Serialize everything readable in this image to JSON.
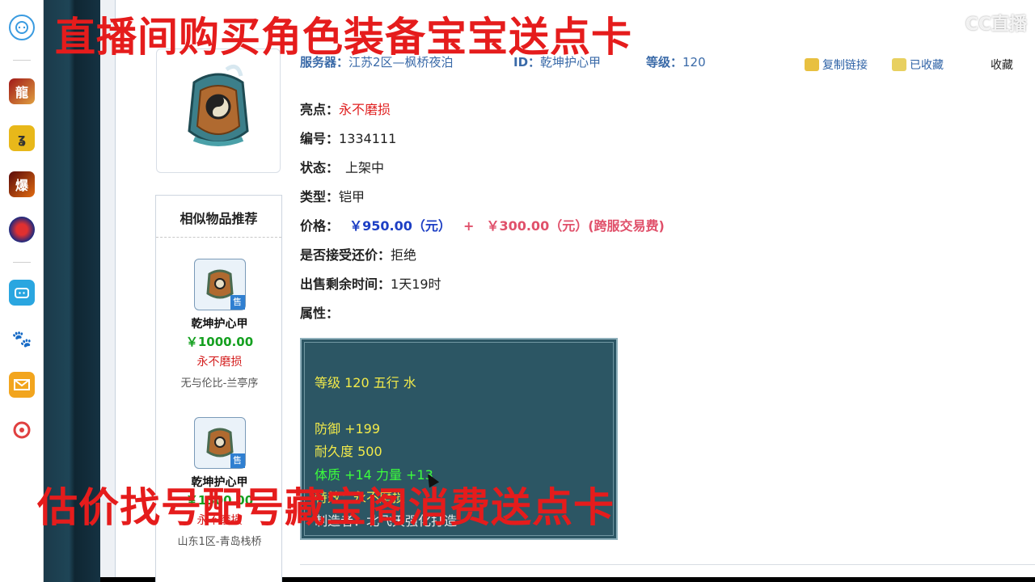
{
  "overlay": {
    "top_text": "直播间购买角色装备宝宝送点卡",
    "bottom_text": "估价找号配号藏宝阁消费送点卡",
    "watermark": "CC直播"
  },
  "dock": {
    "icons": [
      "chat-icon",
      "game-dragon-icon",
      "game-swirl-icon",
      "game-bao-icon",
      "game-ball-icon",
      "bilibili-icon",
      "baidu-icon",
      "mail-icon",
      "netease-icon"
    ]
  },
  "item": {
    "server_label": "服务器：",
    "server_value": "江苏2区—枫桥夜泊",
    "id_label": "ID：",
    "id_value": "乾坤护心甲",
    "level_label": "等级：",
    "level_value": "120",
    "copy_link": "复制链接",
    "share_label": "已收藏",
    "favorite_label": "收藏",
    "highlight_label": "亮点：",
    "highlight_value": "永不磨损",
    "number_label": "编号：",
    "number_value": "1334111",
    "status_label": "状态：",
    "status_value": "上架中",
    "type_label": "类型：",
    "type_value": "铠甲",
    "price_label": "价格：",
    "price_value": "￥950.00（元）",
    "price_plus": "+",
    "fee_value": "￥300.00（元）(跨服交易费)",
    "bargain_label": "是否接受还价：",
    "bargain_value": "拒绝",
    "remaining_label": "出售剩余时间：",
    "remaining_value": "1天19时",
    "attr_label": "属性："
  },
  "attributes": {
    "line1": "等级  120  五行  水",
    "line2": "防御  +199",
    "line3": "耐久度  500",
    "line4": "体质  +14  力量  +13",
    "line5": "特效：永不磨损",
    "line6": "制造者：北飞天强化打造"
  },
  "sidebar": {
    "title": "相似物品推荐",
    "items": [
      {
        "name": "乾坤护心甲",
        "price": "￥1000.00",
        "feature": "永不磨损",
        "server": "无与伦比-兰亭序",
        "tag": "售"
      },
      {
        "name": "乾坤护心甲",
        "price": "￥1300.00",
        "feature": "永不磨损",
        "server": "山东1区-青岛栈桥",
        "tag": "售"
      }
    ]
  }
}
